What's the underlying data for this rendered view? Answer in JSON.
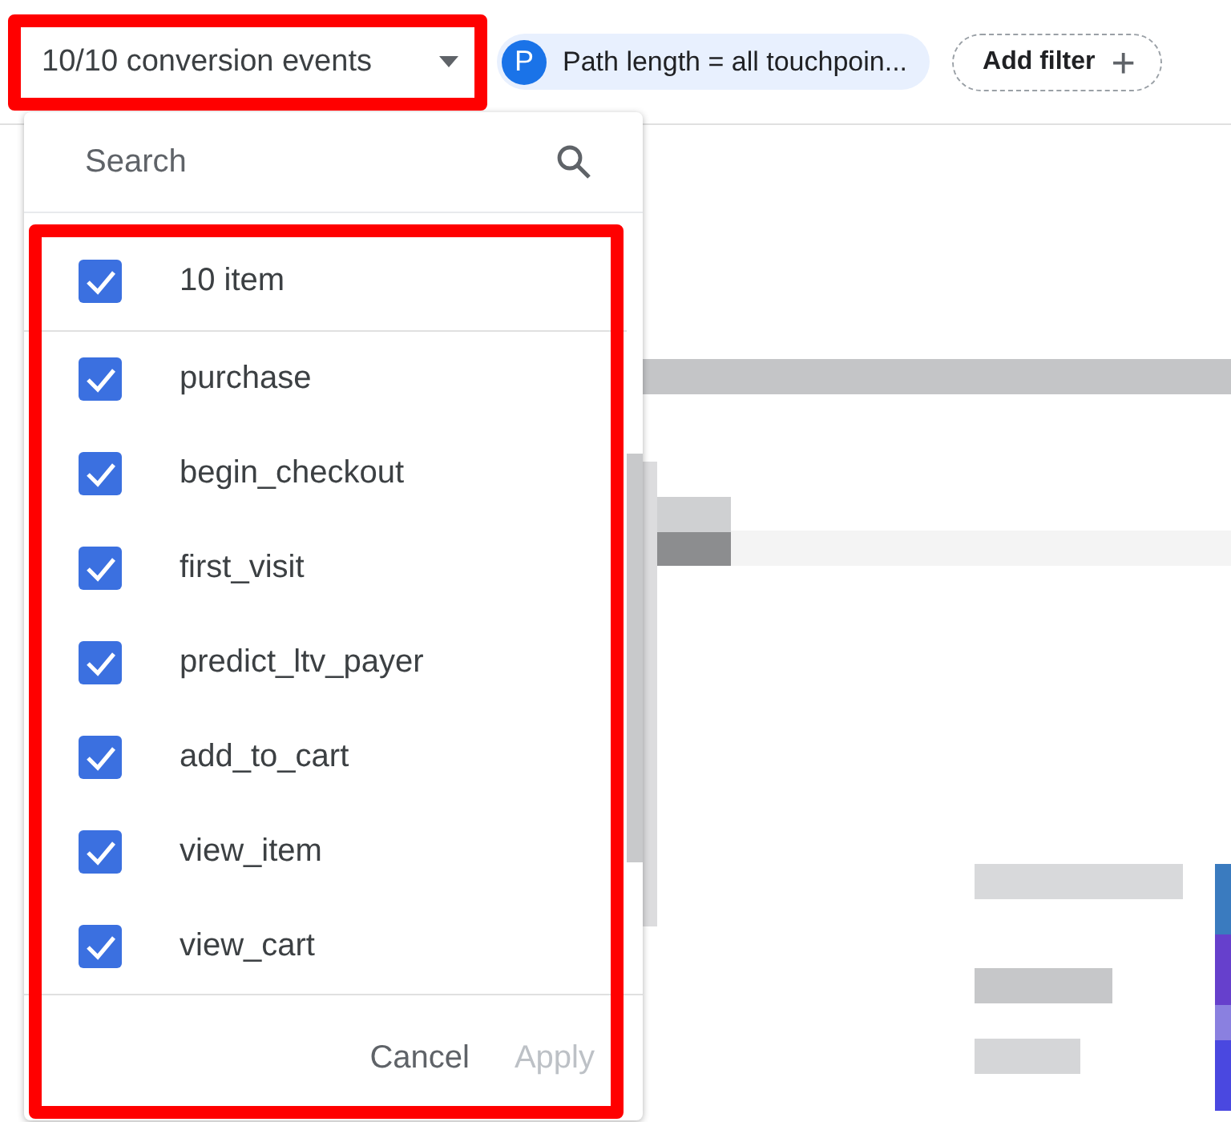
{
  "filter_bar": {
    "events_dropdown": {
      "label": "10/10 conversion events"
    },
    "chip": {
      "avatar": "P",
      "label": "Path length = all touchpoin..."
    },
    "add_filter": {
      "label": "Add filter",
      "icon": "+"
    }
  },
  "events_menu": {
    "search": {
      "placeholder": "Search"
    },
    "select_all": {
      "label": "10 item",
      "checked": true
    },
    "items": [
      {
        "label": "purchase",
        "checked": true
      },
      {
        "label": "begin_checkout",
        "checked": true
      },
      {
        "label": "first_visit",
        "checked": true
      },
      {
        "label": "predict_ltv_payer",
        "checked": true
      },
      {
        "label": "add_to_cart",
        "checked": true
      },
      {
        "label": "view_item",
        "checked": true
      },
      {
        "label": "view_cart",
        "checked": true
      }
    ],
    "buttons": [
      {
        "label": "Cancel",
        "disabled": false
      },
      {
        "label": "Apply",
        "disabled": true
      }
    ]
  }
}
